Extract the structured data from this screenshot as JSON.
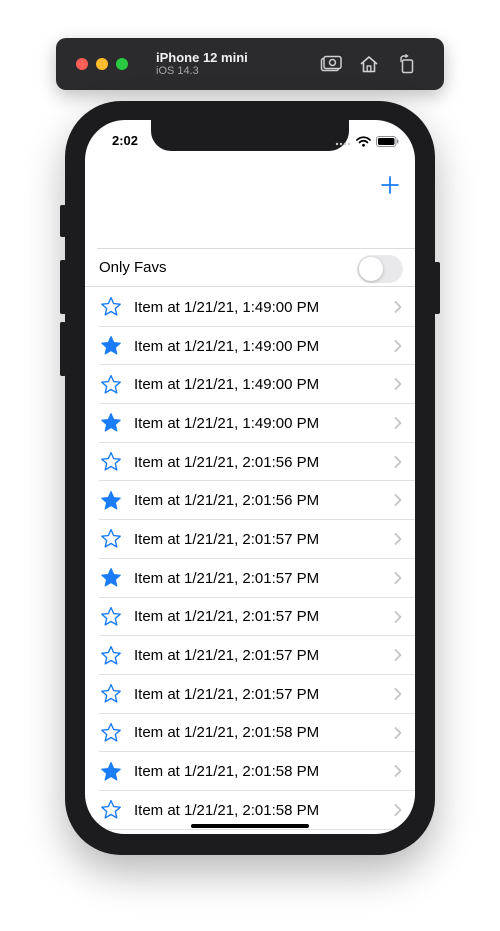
{
  "simulator": {
    "device_name": "iPhone 12 mini",
    "os_version": "iOS 14.3",
    "traffic_colors": [
      "#ff5f57",
      "#febc2e",
      "#28c840"
    ]
  },
  "status_bar": {
    "time": "2:02"
  },
  "nav": {
    "add_icon": "plus-icon",
    "accent": "#1a7cf6"
  },
  "toggle": {
    "label": "Only Favs",
    "on": false
  },
  "items": [
    {
      "label": "Item at 1/21/21, 1:49:00 PM",
      "favorite": false
    },
    {
      "label": "Item at 1/21/21, 1:49:00 PM",
      "favorite": true
    },
    {
      "label": "Item at 1/21/21, 1:49:00 PM",
      "favorite": false
    },
    {
      "label": "Item at 1/21/21, 1:49:00 PM",
      "favorite": true
    },
    {
      "label": "Item at 1/21/21, 2:01:56 PM",
      "favorite": false
    },
    {
      "label": "Item at 1/21/21, 2:01:56 PM",
      "favorite": true
    },
    {
      "label": "Item at 1/21/21, 2:01:57 PM",
      "favorite": false
    },
    {
      "label": "Item at 1/21/21, 2:01:57 PM",
      "favorite": true
    },
    {
      "label": "Item at 1/21/21, 2:01:57 PM",
      "favorite": false
    },
    {
      "label": "Item at 1/21/21, 2:01:57 PM",
      "favorite": false
    },
    {
      "label": "Item at 1/21/21, 2:01:57 PM",
      "favorite": false
    },
    {
      "label": "Item at 1/21/21, 2:01:58 PM",
      "favorite": false
    },
    {
      "label": "Item at 1/21/21, 2:01:58 PM",
      "favorite": true
    },
    {
      "label": "Item at 1/21/21, 2:01:58 PM",
      "favorite": false
    }
  ]
}
